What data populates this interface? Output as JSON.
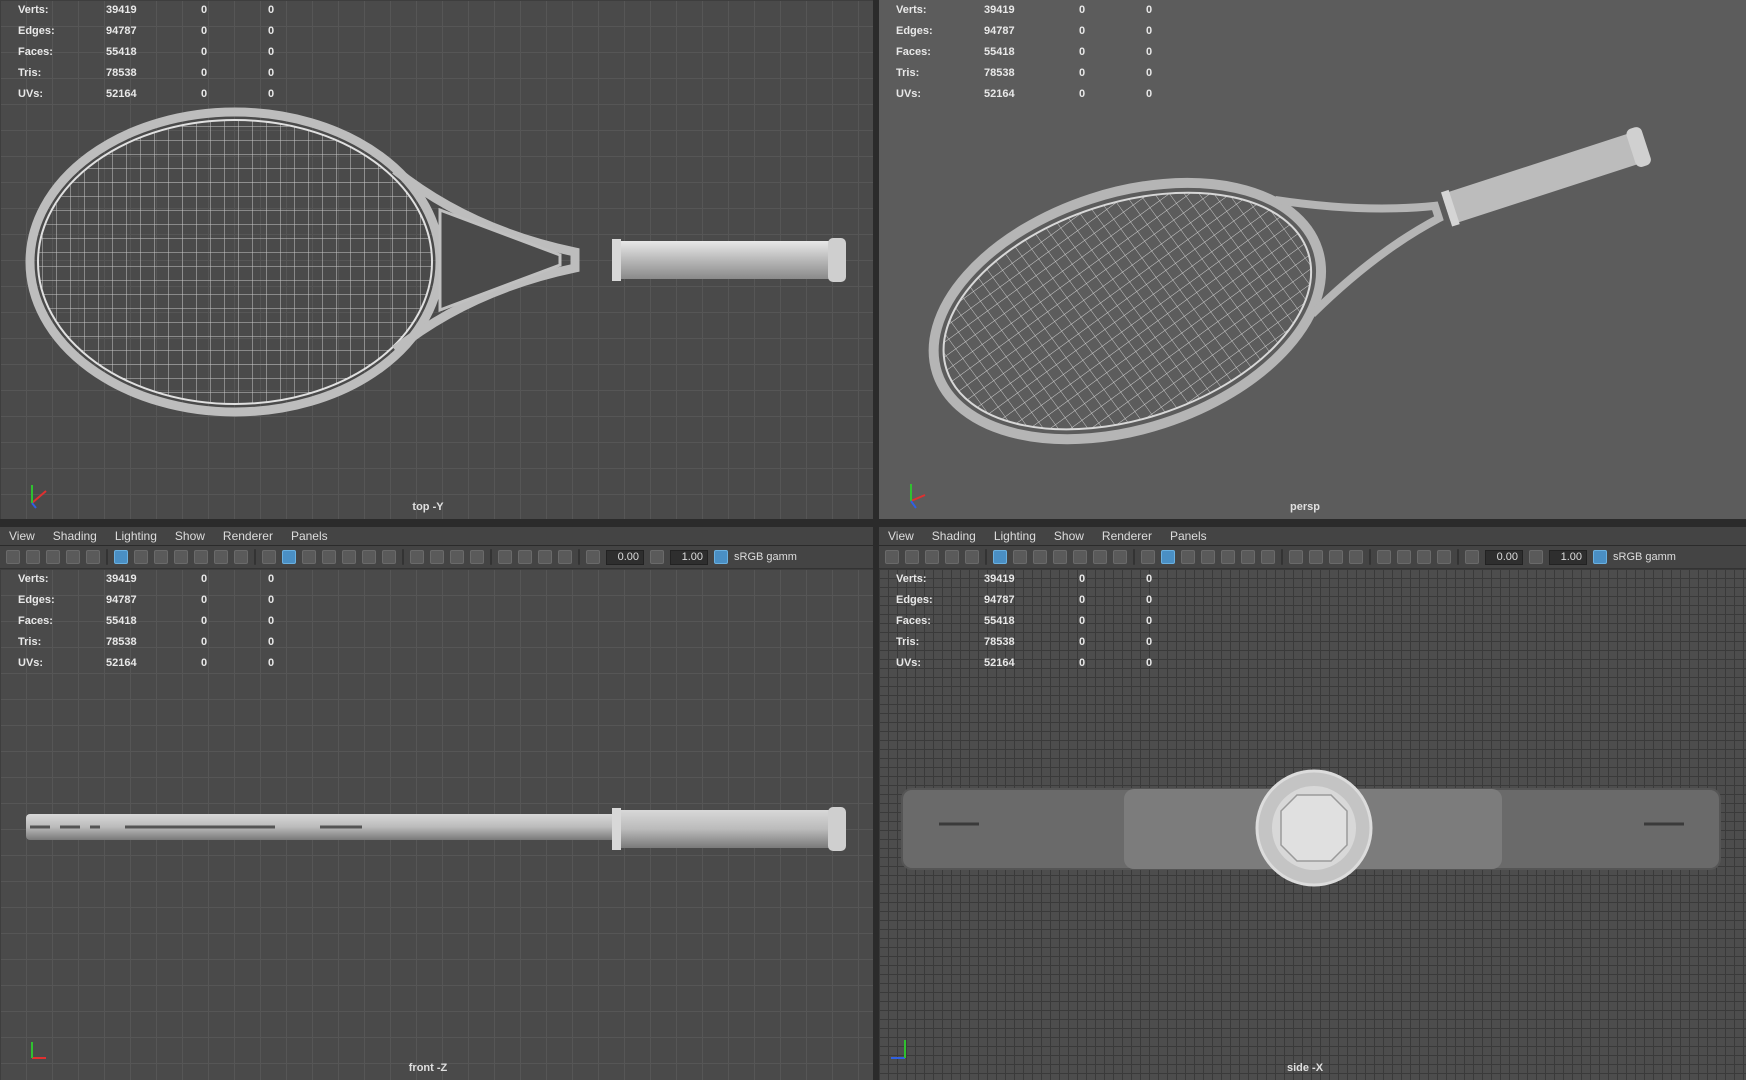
{
  "stats_rows": [
    {
      "label": "Verts:",
      "total": "39419",
      "sel": "0",
      "comp": "0"
    },
    {
      "label": "Edges:",
      "total": "94787",
      "sel": "0",
      "comp": "0"
    },
    {
      "label": "Faces:",
      "total": "55418",
      "sel": "0",
      "comp": "0"
    },
    {
      "label": "Tris:",
      "total": "78538",
      "sel": "0",
      "comp": "0"
    },
    {
      "label": "UVs:",
      "total": "52164",
      "sel": "0",
      "comp": "0"
    }
  ],
  "viewports": {
    "top": {
      "camera": "top -Y"
    },
    "persp": {
      "camera": "persp"
    },
    "front": {
      "camera": "front -Z"
    },
    "side": {
      "camera": "side -X"
    }
  },
  "menu": [
    "View",
    "Shading",
    "Lighting",
    "Show",
    "Renderer",
    "Panels"
  ],
  "toolbar": {
    "exposure": "0.00",
    "gamma": "1.00",
    "color_space": "sRGB gamm"
  },
  "icons": {
    "axis": "axis-gizmo-icon"
  },
  "colors": {
    "axis_x": "#e03030",
    "axis_y": "#30c030",
    "axis_z": "#3060e0"
  }
}
